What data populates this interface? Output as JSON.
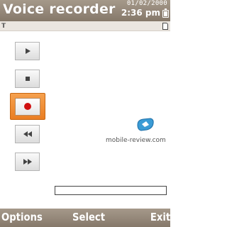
{
  "app": {
    "title": "Voice recorder"
  },
  "status": {
    "date": "01/02/2000",
    "time": "2:36 pm"
  },
  "icons": {
    "signal": "antenna-signal-icon",
    "sim": "sim-card-icon",
    "battery": "battery-icon"
  },
  "controls": [
    {
      "id": "play",
      "icon": "play-icon",
      "active": false
    },
    {
      "id": "stop",
      "icon": "stop-icon",
      "active": false
    },
    {
      "id": "record",
      "icon": "record-icon",
      "active": true
    },
    {
      "id": "rewind",
      "icon": "rewind-icon",
      "active": false
    },
    {
      "id": "fast-forward",
      "icon": "fast-forward-icon",
      "active": false
    }
  ],
  "watermark": {
    "text": "mobile-review.com"
  },
  "recording": {
    "progress_fraction": 0.0
  },
  "softkeys": {
    "left": "Options",
    "center": "Select",
    "right": "Exit"
  },
  "colors": {
    "bar_top": "#a5998a",
    "bar_bottom": "#857869",
    "accent": "#ea7e22",
    "record_dot": "#d01010"
  }
}
